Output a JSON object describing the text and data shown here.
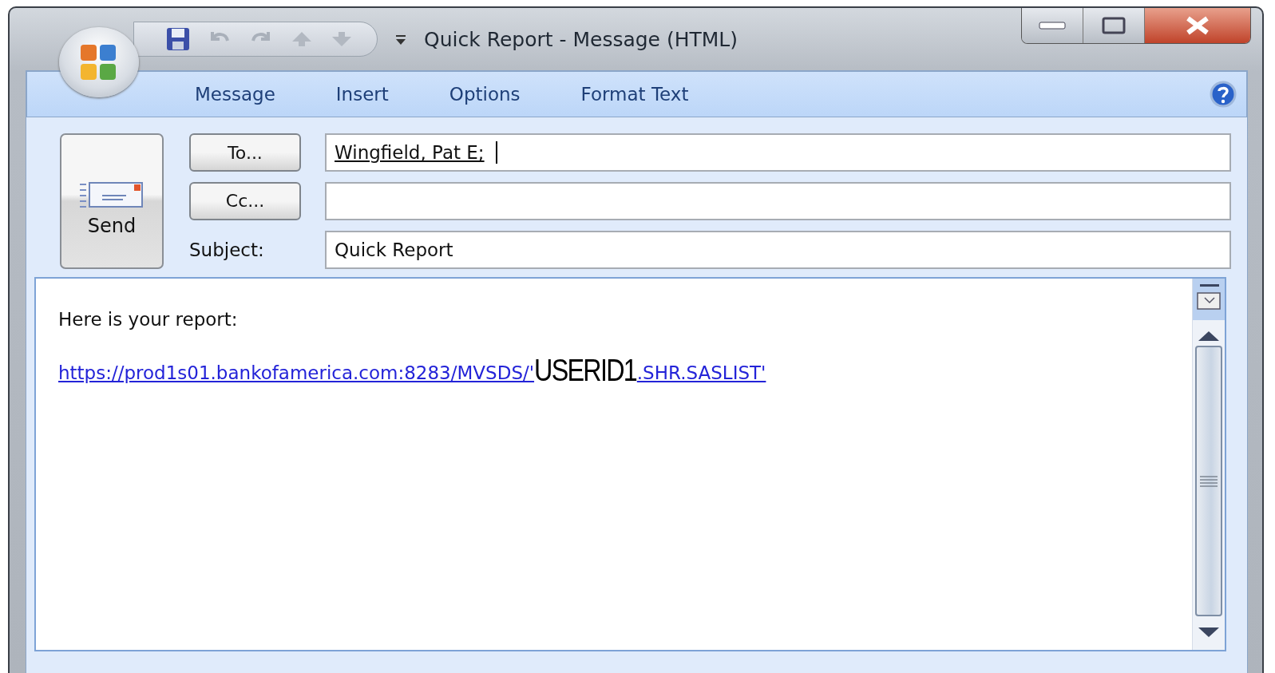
{
  "window": {
    "title": "Quick Report - Message (HTML)"
  },
  "tabs": [
    {
      "label": "Message"
    },
    {
      "label": "Insert"
    },
    {
      "label": "Options"
    },
    {
      "label": "Format Text"
    }
  ],
  "send_button": {
    "label": "Send"
  },
  "to": {
    "button": "To...",
    "value": "Wingfield, Pat E;"
  },
  "cc": {
    "button": "Cc..."
  },
  "subject": {
    "label": "Subject:",
    "value": "Quick Report"
  },
  "body": {
    "text": "Here is your report:",
    "link": {
      "start": "https://prod1s01.bankofamerica.com:8283/MVSDS/'",
      "userid": "USERID1",
      "end": ".SHR.SASLIST'"
    }
  }
}
